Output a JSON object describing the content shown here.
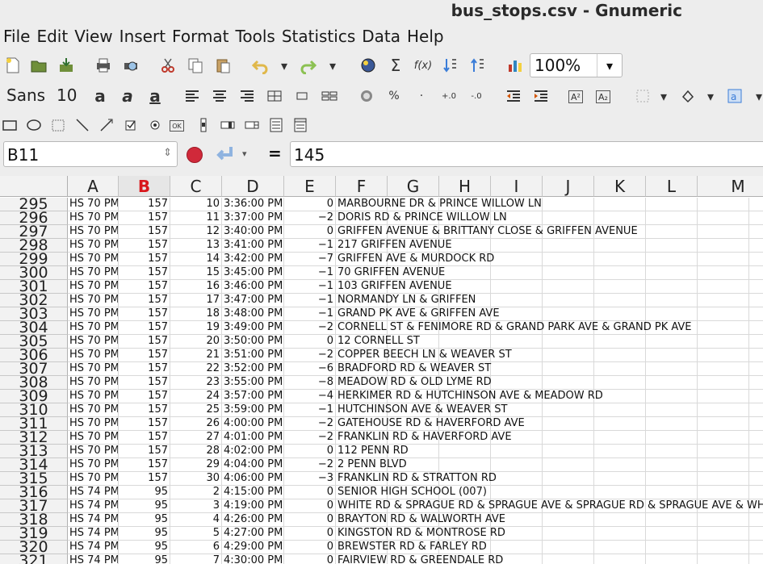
{
  "window": {
    "title": "bus_stops.csv - Gnumeric"
  },
  "menu": [
    "File",
    "Edit",
    "View",
    "Insert",
    "Format",
    "Tools",
    "Statistics",
    "Data",
    "Help"
  ],
  "toolbar": {
    "zoom": "100%"
  },
  "format_toolbar": {
    "font_name": "Sans",
    "font_size": "10"
  },
  "formula_bar": {
    "cell_ref": "B11",
    "equals": "=",
    "value": "145"
  },
  "columns": [
    "A",
    "B",
    "C",
    "D",
    "E",
    "F",
    "G",
    "H",
    "I",
    "J",
    "K",
    "L",
    "M"
  ],
  "active_column": "B",
  "rows": [
    {
      "n": "295",
      "a": "HS 70 PM",
      "b": "157",
      "c": "10",
      "d": "3:36:00 PM",
      "e": "0",
      "f": "MARBOURNE DR & PRINCE WILLOW LN"
    },
    {
      "n": "296",
      "a": "HS 70 PM",
      "b": "157",
      "c": "11",
      "d": "3:37:00 PM",
      "e": "−2",
      "f": "DORIS RD & PRINCE WILLOW LN"
    },
    {
      "n": "297",
      "a": "HS 70 PM",
      "b": "157",
      "c": "12",
      "d": "3:40:00 PM",
      "e": "0",
      "f": "GRIFFEN AVENUE & BRITTANY CLOSE & GRIFFEN AVENUE"
    },
    {
      "n": "298",
      "a": "HS 70 PM",
      "b": "157",
      "c": "13",
      "d": "3:41:00 PM",
      "e": "−1",
      "f": "217 GRIFFEN AVENUE"
    },
    {
      "n": "299",
      "a": "HS 70 PM",
      "b": "157",
      "c": "14",
      "d": "3:42:00 PM",
      "e": "−7",
      "f": "GRIFFEN AVE & MURDOCK RD"
    },
    {
      "n": "300",
      "a": "HS 70 PM",
      "b": "157",
      "c": "15",
      "d": "3:45:00 PM",
      "e": "−1",
      "f": "70 GRIFFEN AVENUE"
    },
    {
      "n": "301",
      "a": "HS 70 PM",
      "b": "157",
      "c": "16",
      "d": "3:46:00 PM",
      "e": "−1",
      "f": "103 GRIFFEN AVENUE"
    },
    {
      "n": "302",
      "a": "HS 70 PM",
      "b": "157",
      "c": "17",
      "d": "3:47:00 PM",
      "e": "−1",
      "f": "NORMANDY LN & GRIFFEN"
    },
    {
      "n": "303",
      "a": "HS 70 PM",
      "b": "157",
      "c": "18",
      "d": "3:48:00 PM",
      "e": "−1",
      "f": "GRAND PK AVE & GRIFFEN AVE"
    },
    {
      "n": "304",
      "a": "HS 70 PM",
      "b": "157",
      "c": "19",
      "d": "3:49:00 PM",
      "e": "−2",
      "f": "CORNELL ST & FENIMORE RD & GRAND PARK AVE & GRAND PK AVE"
    },
    {
      "n": "305",
      "a": "HS 70 PM",
      "b": "157",
      "c": "20",
      "d": "3:50:00 PM",
      "e": "0",
      "f": "12 CORNELL ST"
    },
    {
      "n": "306",
      "a": "HS 70 PM",
      "b": "157",
      "c": "21",
      "d": "3:51:00 PM",
      "e": "−2",
      "f": "COPPER BEECH LN & WEAVER ST"
    },
    {
      "n": "307",
      "a": "HS 70 PM",
      "b": "157",
      "c": "22",
      "d": "3:52:00 PM",
      "e": "−6",
      "f": "BRADFORD RD & WEAVER ST"
    },
    {
      "n": "308",
      "a": "HS 70 PM",
      "b": "157",
      "c": "23",
      "d": "3:55:00 PM",
      "e": "−8",
      "f": "MEADOW RD & OLD LYME RD"
    },
    {
      "n": "309",
      "a": "HS 70 PM",
      "b": "157",
      "c": "24",
      "d": "3:57:00 PM",
      "e": "−4",
      "f": "HERKIMER RD & HUTCHINSON AVE & MEADOW RD"
    },
    {
      "n": "310",
      "a": "HS 70 PM",
      "b": "157",
      "c": "25",
      "d": "3:59:00 PM",
      "e": "−1",
      "f": "HUTCHINSON AVE & WEAVER ST"
    },
    {
      "n": "311",
      "a": "HS 70 PM",
      "b": "157",
      "c": "26",
      "d": "4:00:00 PM",
      "e": "−2",
      "f": "GATEHOUSE RD & HAVERFORD AVE"
    },
    {
      "n": "312",
      "a": "HS 70 PM",
      "b": "157",
      "c": "27",
      "d": "4:01:00 PM",
      "e": "−2",
      "f": "FRANKLIN RD & HAVERFORD AVE"
    },
    {
      "n": "313",
      "a": "HS 70 PM",
      "b": "157",
      "c": "28",
      "d": "4:02:00 PM",
      "e": "0",
      "f": "112 PENN RD"
    },
    {
      "n": "314",
      "a": "HS 70 PM",
      "b": "157",
      "c": "29",
      "d": "4:04:00 PM",
      "e": "−2",
      "f": "2 PENN BLVD"
    },
    {
      "n": "315",
      "a": "HS 70 PM",
      "b": "157",
      "c": "30",
      "d": "4:06:00 PM",
      "e": "−3",
      "f": "FRANKLIN RD & STRATTON RD"
    },
    {
      "n": "316",
      "a": "HS 74 PM",
      "b": "95",
      "c": "2",
      "d": "4:15:00 PM",
      "e": "0",
      "f": "SENIOR HIGH SCHOOL (007)"
    },
    {
      "n": "317",
      "a": "HS 74 PM",
      "b": "95",
      "c": "3",
      "d": "4:19:00 PM",
      "e": "0",
      "f": "WHITE RD & SPRAGUE RD & SPRAGUE AVE & SPRAGUE RD & SPRAGUE AVE & WHITE"
    },
    {
      "n": "318",
      "a": "HS 74 PM",
      "b": "95",
      "c": "4",
      "d": "4:26:00 PM",
      "e": "0",
      "f": "BRAYTON RD & WALWORTH AVE"
    },
    {
      "n": "319",
      "a": "HS 74 PM",
      "b": "95",
      "c": "5",
      "d": "4:27:00 PM",
      "e": "0",
      "f": "KINGSTON RD & MONTROSE RD"
    },
    {
      "n": "320",
      "a": "HS 74 PM",
      "b": "95",
      "c": "6",
      "d": "4:29:00 PM",
      "e": "0",
      "f": "BREWSTER RD & FARLEY RD"
    },
    {
      "n": "321",
      "a": "HS 74 PM",
      "b": "95",
      "c": "7",
      "d": "4:30:00 PM",
      "e": "0",
      "f": "FAIRVIEW RD & GREENDALE RD"
    }
  ]
}
